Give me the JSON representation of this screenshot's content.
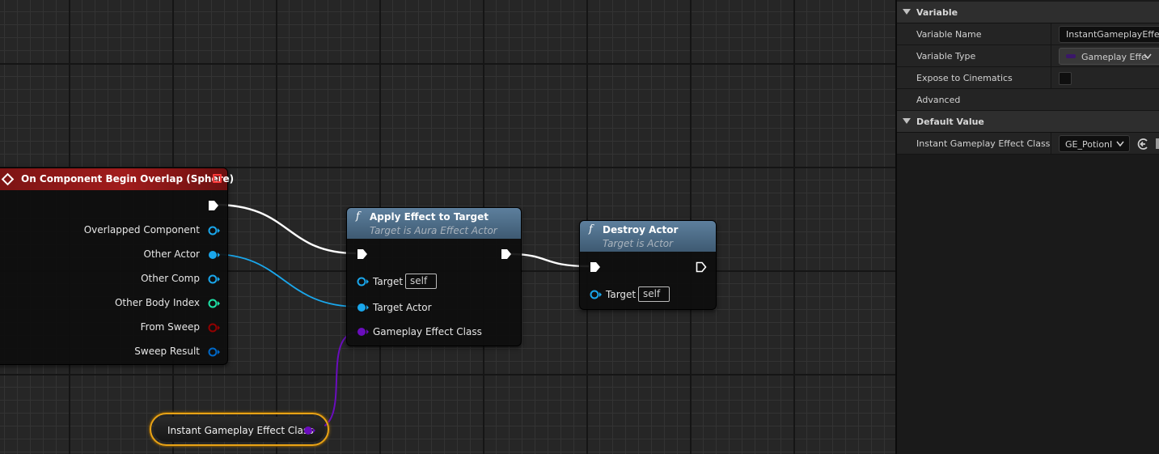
{
  "graph": {
    "event_node": {
      "title": "On Component Begin Overlap (Sphere)",
      "pins": [
        {
          "label": "Overlapped Component"
        },
        {
          "label": "Other Actor"
        },
        {
          "label": "Other Comp"
        },
        {
          "label": "Other Body Index"
        },
        {
          "label": "From Sweep"
        },
        {
          "label": "Sweep Result"
        }
      ]
    },
    "apply_node": {
      "icon": "f",
      "title": "Apply Effect to Target",
      "subtitle": "Target is Aura Effect Actor",
      "pins": {
        "target": "Target",
        "target_default": "self",
        "target_actor": "Target Actor",
        "effect_class": "Gameplay Effect Class"
      }
    },
    "destroy_node": {
      "icon": "f",
      "title": "Destroy Actor",
      "subtitle": "Target is Actor",
      "pins": {
        "target": "Target",
        "target_default": "self"
      }
    },
    "variable_node": {
      "label": "Instant Gameplay Effect Class"
    }
  },
  "details": {
    "variable_section": {
      "title": "Variable",
      "name_label": "Variable Name",
      "name_value": "InstantGameplayEffectC",
      "type_label": "Variable Type",
      "type_value": "Gameplay Effe",
      "expose_label": "Expose to Cinematics"
    },
    "advanced_label": "Advanced",
    "default_section": {
      "title": "Default Value",
      "row_label": "Instant Gameplay Effect Class",
      "row_value": "GE_PotionI"
    }
  },
  "colors": {
    "exec_wire": "#ffffff",
    "object_pin": "#1aa7ec",
    "class_pin": "#6a0dbd",
    "int_pin": "#1fe3a8",
    "bool_pin": "#920101",
    "struct_pin": "#0068c8",
    "event_header": "#a11c1c",
    "function_header": "#5c7f9c",
    "variable_outline": "#e8a317"
  }
}
